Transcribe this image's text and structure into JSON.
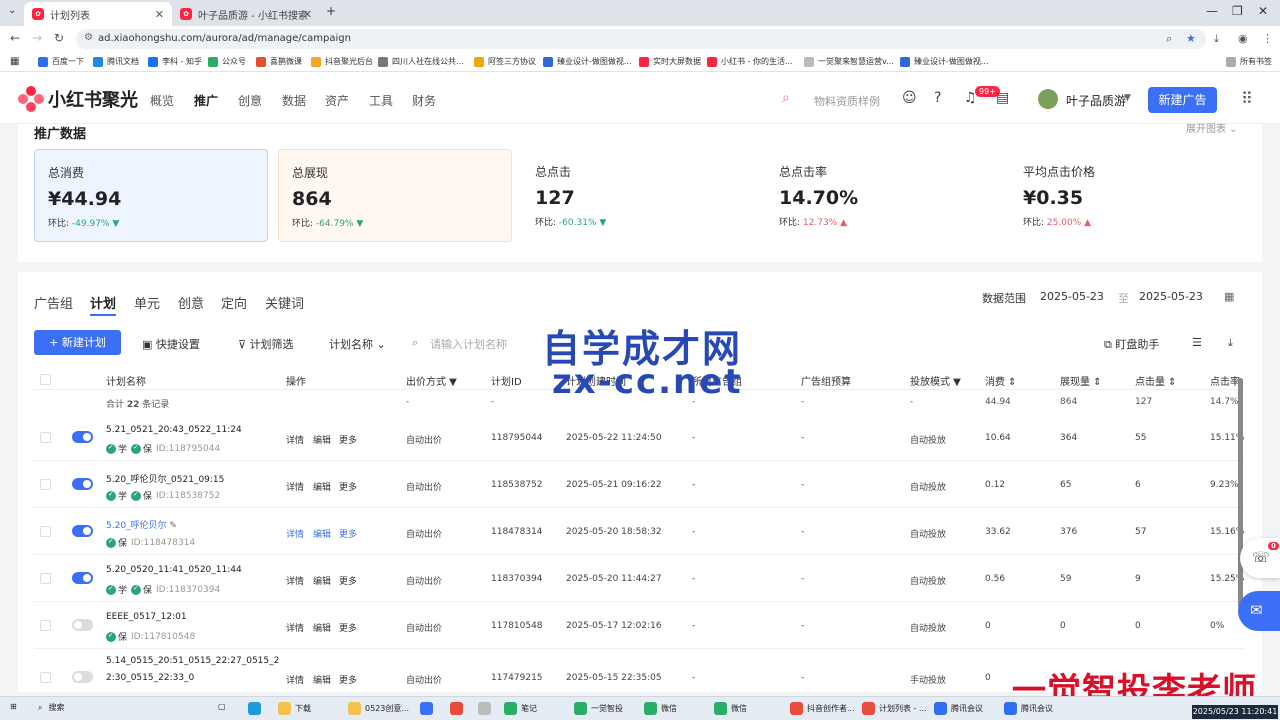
{
  "browser": {
    "tabs": [
      {
        "label": "计划列表"
      },
      {
        "label": "叶子品质游 - 小红书搜索"
      }
    ],
    "new_tab": "+",
    "url": "ad.xiaohongshu.com/aurora/ad/manage/campaign",
    "bookmarks": [
      "百度一下",
      "腾讯文档",
      "李科 - 知乎",
      "公众号",
      "喜鹊微课",
      "抖音聚光后台",
      "四川人社在线公共...",
      "阿签三方协议",
      "臻业设计-做图做视...",
      "实时大屏数据",
      "小红书 - 你的生活...",
      "一觉聚来智慧运营v...",
      "臻业设计-做图做视...",
      "所有书签"
    ]
  },
  "app": {
    "logo_text": "小红书聚光",
    "nav": [
      "概览",
      "推广",
      "创意",
      "数据",
      "资产",
      "工具",
      "财务"
    ],
    "active_nav": "推广",
    "search_hint": "物料资质样例",
    "notif_badge": "99+",
    "username": "叶子品质游",
    "new_ad_label": "新建广告"
  },
  "promo": {
    "title": "推广数据",
    "expand_label": "展开图表",
    "cmp_label": "环比:",
    "metrics": [
      {
        "label": "总消费",
        "value": "¥44.94",
        "change": "-49.97%",
        "trend": "down"
      },
      {
        "label": "总展现",
        "value": "864",
        "change": "-64.79%",
        "trend": "down"
      },
      {
        "label": "总点击",
        "value": "127",
        "change": "-60.31%",
        "trend": "down"
      },
      {
        "label": "总点击率",
        "value": "14.70%",
        "change": "12.73%",
        "trend": "up"
      },
      {
        "label": "平均点击价格",
        "value": "¥0.35",
        "change": "25.00%",
        "trend": "up"
      }
    ]
  },
  "list": {
    "subtabs": [
      "广告组",
      "计划",
      "单元",
      "创意",
      "定向",
      "关键词"
    ],
    "active_subtab": "计划",
    "date_range_label": "数据范围",
    "date_start": "2025-05-23",
    "date_sep": "至",
    "date_end": "2025-05-23",
    "new_plan_label": "+ 新建计划",
    "quick_setting": "快捷设置",
    "plan_filter": "计划筛选",
    "plan_name_select": "计划名称",
    "search_placeholder": "请输入计划名称",
    "assistant": "盯盘助手",
    "columns": [
      "计划名称",
      "操作",
      "出价方式",
      "计划ID",
      "计划创建时间",
      "所属广告组",
      "广告组预算",
      "投放模式",
      "消费",
      "展现量",
      "点击量",
      "点击率"
    ],
    "summary": {
      "label_prefix": "合计",
      "count": "22",
      "label_suffix": "条记录",
      "dash": "-",
      "spend": "44.94",
      "impressions": "864",
      "clicks": "127",
      "ctr": "14.7%"
    },
    "ops": [
      "详情",
      "编辑",
      "更多"
    ],
    "tag_xue": "学",
    "tag_bao": "保",
    "rows": [
      {
        "name": "5.21_0521_20:43_0522_11:24",
        "id_text": "ID:118795044",
        "bid": "自动出价",
        "plan_id": "118795044",
        "created": "2025-05-22 11:24:50",
        "group": "-",
        "budget": "-",
        "mode": "自动投放",
        "spend": "10.64",
        "imp": "364",
        "clicks": "55",
        "ctr": "15.11%"
      },
      {
        "name": "5.20_呼伦贝尔_0521_09:15",
        "id_text": "ID:118538752",
        "bid": "自动出价",
        "plan_id": "118538752",
        "created": "2025-05-21 09:16:22",
        "group": "-",
        "budget": "-",
        "mode": "自动投放",
        "spend": "0.12",
        "imp": "65",
        "clicks": "6",
        "ctr": "9.23%"
      },
      {
        "name": "5.20_呼伦贝尔",
        "id_text": "ID:118478314",
        "bid": "自动出价",
        "plan_id": "118478314",
        "created": "2025-05-20 18:58:32",
        "group": "-",
        "budget": "-",
        "mode": "自动投放",
        "spend": "33.62",
        "imp": "376",
        "clicks": "57",
        "ctr": "15.16%"
      },
      {
        "name": "5.20_0520_11:41_0520_11:44",
        "id_text": "ID:118370394",
        "bid": "自动出价",
        "plan_id": "118370394",
        "created": "2025-05-20 11:44:27",
        "group": "-",
        "budget": "-",
        "mode": "自动投放",
        "spend": "0.56",
        "imp": "59",
        "clicks": "9",
        "ctr": "15.25%"
      },
      {
        "name": "EEEE_0517_12:01",
        "id_text": "ID:117810548",
        "bid": "自动出价",
        "plan_id": "117810548",
        "created": "2025-05-17 12:02:16",
        "group": "-",
        "budget": "-",
        "mode": "自动投放",
        "spend": "0",
        "imp": "0",
        "clicks": "0",
        "ctr": "0%"
      },
      {
        "name": "5.14_0515_20:51_0515_22:27_0515_2",
        "name2": "2:30_0515_22:33_0",
        "bid": "自动出价",
        "plan_id": "117479215",
        "created": "2025-05-15 22:35:05",
        "group": "-",
        "budget": "-",
        "mode": "手动投放",
        "spend": "0",
        "imp": "0",
        "clicks": "0",
        "ctr": ""
      }
    ]
  },
  "overlay": {
    "watermark_line1": "自学成才网",
    "watermark_line2": "zx-cc.net",
    "teacher_text": "一觉智投李老师",
    "float_badge": "0"
  },
  "taskbar": {
    "search": "搜索",
    "items": [
      "下载",
      "0523创意...",
      "笔记",
      "一觉智投",
      "微信",
      "微信",
      "抖音创作者...",
      "计划列表 - ...",
      "腾讯会议",
      "腾讯会议"
    ],
    "clock": "2025/05/23 11:20:41"
  },
  "colors": {
    "accent": "#3b6ff5",
    "brand_red": "#ff2442",
    "down_green": "#2ba57a",
    "up_red": "#ef5a66"
  }
}
